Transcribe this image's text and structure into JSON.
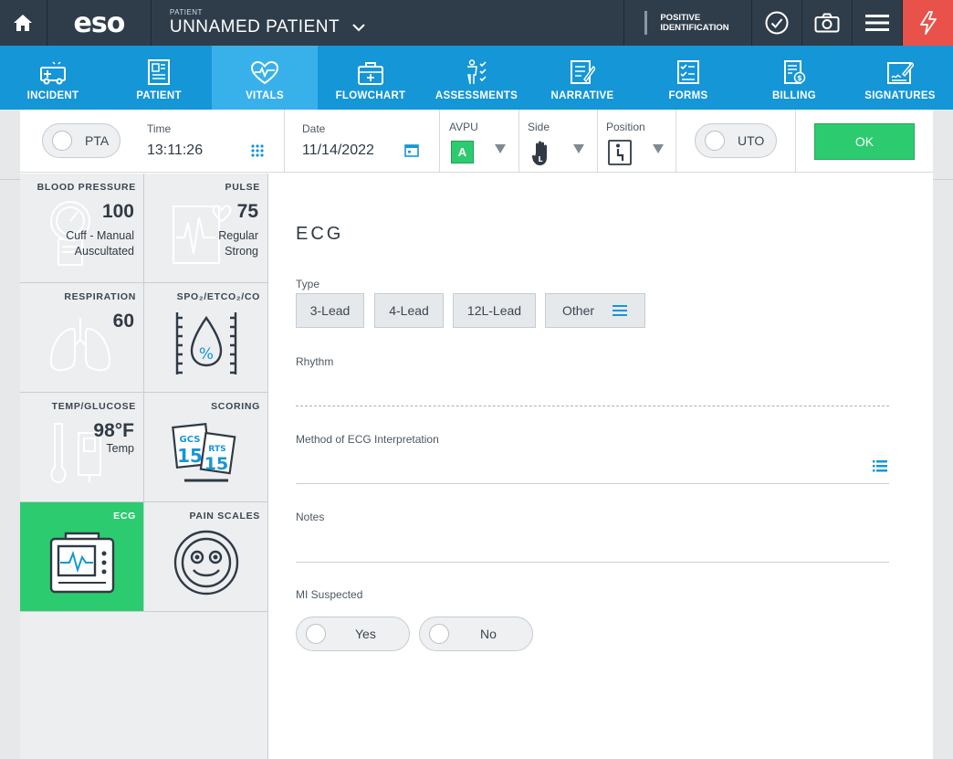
{
  "header": {
    "patient_label": "PATIENT",
    "patient_name": "UNNAMED PATIENT",
    "logo": "eso",
    "positive_id_line1": "POSITIVE",
    "positive_id_line2": "IDENTIFICATION",
    "icons": [
      "home-icon",
      "chevron-down-icon",
      "check-circle-icon",
      "camera-icon",
      "menu-icon",
      "flash-icon"
    ],
    "flash_color": "#e8524a"
  },
  "nav": {
    "items": [
      {
        "label": "INCIDENT",
        "icon": "ambulance-icon"
      },
      {
        "label": "PATIENT",
        "icon": "patient-id-icon"
      },
      {
        "label": "VITALS",
        "icon": "heart-pulse-icon",
        "active": true
      },
      {
        "label": "FLOWCHART",
        "icon": "medkit-icon"
      },
      {
        "label": "ASSESSMENTS",
        "icon": "body-checklist-icon"
      },
      {
        "label": "NARRATIVE",
        "icon": "notepad-icon"
      },
      {
        "label": "FORMS",
        "icon": "checklist-icon"
      },
      {
        "label": "BILLING",
        "icon": "invoice-icon"
      },
      {
        "label": "SIGNATURES",
        "icon": "signature-icon"
      }
    ],
    "color": "#1596d6",
    "active_color": "#38b1eb"
  },
  "entry": {
    "pta": "PTA",
    "time_label": "Time",
    "time_value": "13:11:26",
    "date_label": "Date",
    "date_value": "11/14/2022",
    "avpu_label": "AVPU",
    "avpu_value": "A",
    "side_label": "Side",
    "position_label": "Position",
    "uto": "UTO",
    "ok": "OK"
  },
  "tiles": {
    "blood_pressure": {
      "title": "BLOOD PRESSURE",
      "value": "100",
      "line1": "Cuff - Manual",
      "line2": "Auscultated"
    },
    "pulse": {
      "title": "PULSE",
      "value": "75",
      "line1": "Regular",
      "line2": "Strong"
    },
    "respiration": {
      "title": "RESPIRATION",
      "value": "60"
    },
    "spo2": {
      "title": "SPO₂/ETCO₂/CO"
    },
    "temp": {
      "title": "TEMP/GLUCOSE",
      "value": "98°F",
      "line1": "Temp"
    },
    "scoring": {
      "title": "SCORING",
      "gcs": "GCS",
      "gcs_val": "15",
      "rts": "RTS",
      "rts_val": "15"
    },
    "ecg": {
      "title": "ECG"
    },
    "pain": {
      "title": "PAIN SCALES"
    }
  },
  "ecg_form": {
    "title": "ECG",
    "type_label": "Type",
    "types": [
      "3-Lead",
      "4-Lead",
      "12L-Lead",
      "Other"
    ],
    "rhythm_label": "Rhythm",
    "method_label": "Method of ECG Interpretation",
    "notes_label": "Notes",
    "mi_label": "MI Suspected",
    "yes": "Yes",
    "no": "No"
  }
}
